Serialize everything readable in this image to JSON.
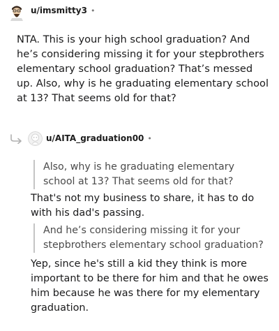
{
  "comment": {
    "username": "u/imsmitty3",
    "separator": "•",
    "body": "NTA. This is your high school graduation? And he’s considering missing it for your stepbrothers elementary school graduation? That’s messed up. Also, why is he graduating elementary school at 13? That seems old for that?"
  },
  "reply": {
    "username": "u/AITA_graduation00",
    "separator": "•",
    "quote1": "Also, why is he graduating elementary school at 13? That seems old for that?",
    "text1": "That's not my business to share, it has to do with his dad's passing.",
    "quote2": "And he’s considering missing it for your stepbrothers elementary school graduation?",
    "text2": "Yep, since he's still a kid they think is more important to be there for him and that he owes him because he was there for my elementary graduation."
  },
  "icons": {
    "avatar_user1": "bearded-avatar-icon",
    "avatar_user2": "default-avatar-icon",
    "reply_indicator": "reply-arrow-icon"
  }
}
